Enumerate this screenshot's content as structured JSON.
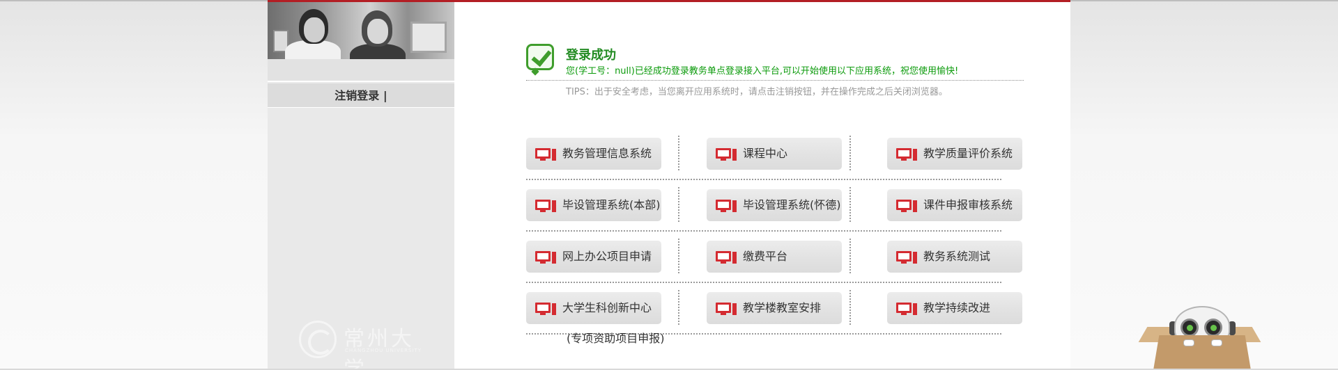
{
  "sidebar": {
    "logout_label": "注销登录 |"
  },
  "university": {
    "logo_text_cn": "常州大学",
    "logo_text_en": "CHANGZHOU UNIVERSITY"
  },
  "status": {
    "title": "登录成功",
    "message": "您(学工号：null)已经成功登录教务单点登录接入平台,可以开始使用以下应用系统，祝您使用愉快!",
    "tips": "TIPS：出于安全考虑，当您离开应用系统时，请点击注销按钮，并在操作完成之后关闭浏览器。"
  },
  "systems": [
    [
      "教务管理信息系统",
      "课程中心",
      "教学质量评价系统"
    ],
    [
      "毕设管理系统(本部)",
      "毕设管理系统(怀德)",
      "课件申报审核系统"
    ],
    [
      "网上办公项目申请",
      "缴费平台",
      "教务系统测试"
    ],
    [
      "大学生科创新中心",
      "教学楼教室安排",
      "教学持续改进"
    ]
  ],
  "extra_note": "(专项资助项目申报)",
  "colors": {
    "accent_red": "#d42b31",
    "success_green": "#228b22",
    "top_bar": "#b31e24"
  },
  "icons": {
    "tile_icon": "computer-icon",
    "status_icon": "checkmark-icon",
    "mascot": "robot-mascot"
  }
}
